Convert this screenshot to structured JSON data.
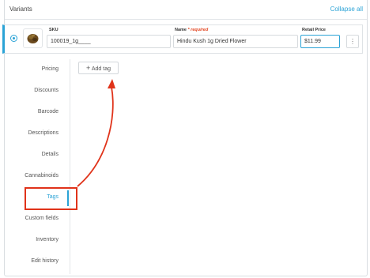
{
  "header": {
    "title": "Variants",
    "collapse_label": "Collapse all"
  },
  "variant": {
    "sku_label": "SKU",
    "sku_value": "100019_1g____",
    "name_label": "Name",
    "name_required": "* required",
    "name_value": "Hindu Kush 1g Dried Flower",
    "price_label": "Retail Price",
    "price_value": "$11.99",
    "more_icon": "⋮"
  },
  "nav": {
    "items": [
      "Pricing",
      "Discounts",
      "Barcode",
      "Descriptions",
      "Details",
      "Cannabinoids",
      "Tags",
      "Custom fields",
      "Inventory",
      "Edit history"
    ],
    "active": "Tags"
  },
  "tags": {
    "add_label": "Add tag"
  },
  "colors": {
    "accent": "#2ba3d6",
    "annotation": "#e0331a"
  }
}
